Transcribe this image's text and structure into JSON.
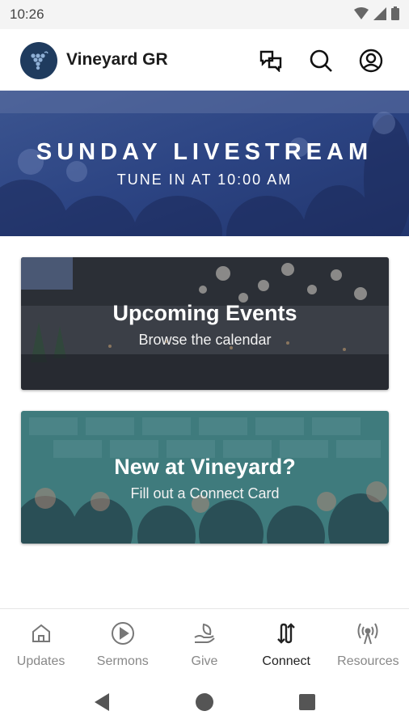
{
  "status_bar": {
    "time": "10:26"
  },
  "header": {
    "title": "Vineyard GR"
  },
  "banner": {
    "title": "SUNDAY LIVESTREAM",
    "subtitle": "TUNE IN AT 10:00 AM"
  },
  "cards": [
    {
      "title": "Upcoming Events",
      "subtitle": "Browse the calendar"
    },
    {
      "title": "New at Vineyard?",
      "subtitle": "Fill out a Connect Card"
    }
  ],
  "bottom_nav": {
    "items": [
      {
        "label": "Updates",
        "icon": "home-icon"
      },
      {
        "label": "Sermons",
        "icon": "play-circle-icon"
      },
      {
        "label": "Give",
        "icon": "leaf-hand-icon"
      },
      {
        "label": "Connect",
        "icon": "connect-arrows-icon"
      },
      {
        "label": "Resources",
        "icon": "broadcast-icon"
      }
    ],
    "active": "Connect"
  },
  "colors": {
    "brand": "#1f3b5e",
    "banner_tint": "#2e4a8a",
    "events_tint": "#3a3f4a",
    "new_tint": "#3f7a7c",
    "active_nav": "#222222",
    "inactive_nav": "#888888"
  }
}
